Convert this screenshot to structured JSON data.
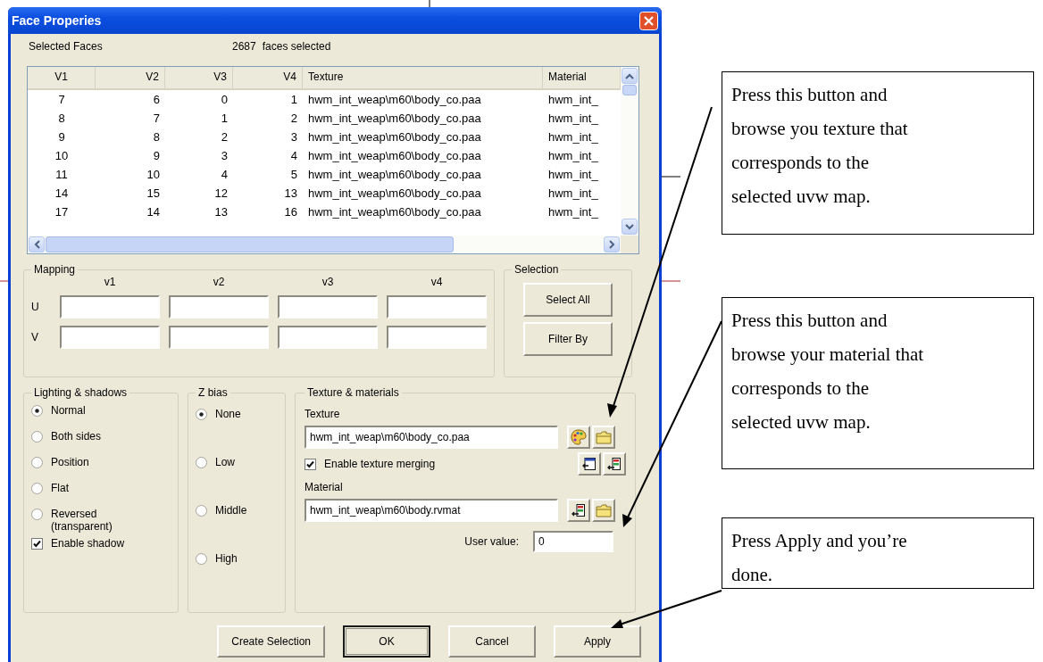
{
  "window": {
    "title": "Face Properies"
  },
  "selected_faces": {
    "label": "Selected Faces",
    "count": "2687",
    "count_label": "faces selected"
  },
  "table": {
    "columns": [
      "V1",
      "V2",
      "V3",
      "V4",
      "Texture",
      "Material"
    ],
    "rows": [
      [
        "7",
        "6",
        "0",
        "1",
        "hwm_int_weap\\m60\\body_co.paa",
        "hwm_int_"
      ],
      [
        "8",
        "7",
        "1",
        "2",
        "hwm_int_weap\\m60\\body_co.paa",
        "hwm_int_"
      ],
      [
        "9",
        "8",
        "2",
        "3",
        "hwm_int_weap\\m60\\body_co.paa",
        "hwm_int_"
      ],
      [
        "10",
        "9",
        "3",
        "4",
        "hwm_int_weap\\m60\\body_co.paa",
        "hwm_int_"
      ],
      [
        "11",
        "10",
        "4",
        "5",
        "hwm_int_weap\\m60\\body_co.paa",
        "hwm_int_"
      ],
      [
        "14",
        "15",
        "12",
        "13",
        "hwm_int_weap\\m60\\body_co.paa",
        "hwm_int_"
      ],
      [
        "17",
        "14",
        "13",
        "16",
        "hwm_int_weap\\m60\\body_co.paa",
        "hwm_int_"
      ]
    ]
  },
  "mapping": {
    "title": "Mapping",
    "columns": [
      "v1",
      "v2",
      "v3",
      "v4"
    ],
    "rows": [
      {
        "label": "U"
      },
      {
        "label": "V"
      }
    ]
  },
  "selection": {
    "title": "Selection",
    "buttons": [
      "Select All",
      "Filter By"
    ]
  },
  "lighting": {
    "title": "Lighting & shadows",
    "options": [
      {
        "label": "Normal",
        "selected": true
      },
      {
        "label": "Both sides",
        "selected": false
      },
      {
        "label": "Position",
        "selected": false
      },
      {
        "label": "Flat",
        "selected": false
      },
      {
        "label": "Reversed (transparent)",
        "selected": false
      }
    ],
    "enable_shadow": {
      "label": "Enable shadow",
      "checked": true
    }
  },
  "z_bias": {
    "title": "Z bias",
    "options": [
      {
        "label": "None",
        "selected": true
      },
      {
        "label": "Low",
        "selected": false
      },
      {
        "label": "Middle",
        "selected": false
      },
      {
        "label": "High",
        "selected": false
      }
    ]
  },
  "texture_materials": {
    "title": "Texture & materials",
    "texture_label": "Texture",
    "texture_value": "hwm_int_weap\\m60\\body_co.paa",
    "merge": {
      "label": "Enable texture merging",
      "checked": true
    },
    "material_label": "Material",
    "material_value": "hwm_int_weap\\m60\\body.rvmat",
    "user_value_label": "User value:",
    "user_value": "0"
  },
  "buttons": [
    {
      "label": "Create Selection",
      "default": false
    },
    {
      "label": "OK",
      "default": true
    },
    {
      "label": "Cancel",
      "default": false
    },
    {
      "label": "Apply",
      "default": false
    }
  ],
  "annotations": [
    {
      "text": "Press this button and browse you texture that corresponds to the selected uvw map."
    },
    {
      "text": "Press this button and browse your material that corresponds to the selected uvw map."
    },
    {
      "text": "Press Apply and you’re done."
    }
  ]
}
